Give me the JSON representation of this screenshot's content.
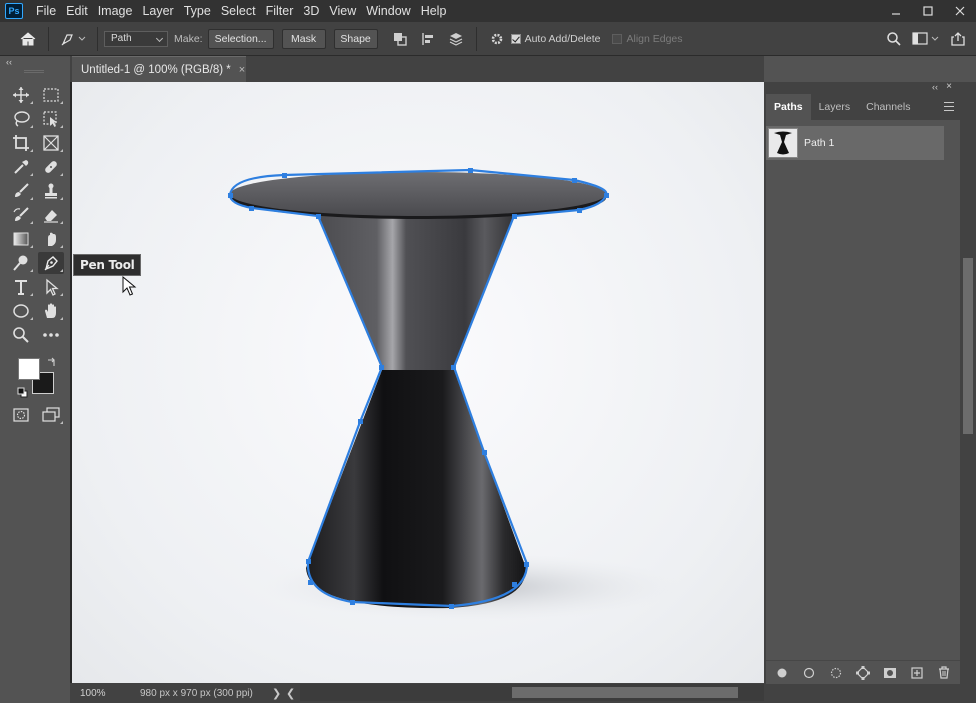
{
  "app": {
    "logo": "Ps"
  },
  "menu": [
    "File",
    "Edit",
    "Image",
    "Layer",
    "Type",
    "Select",
    "Filter",
    "3D",
    "View",
    "Window",
    "Help"
  ],
  "options": {
    "mode_value": "Path",
    "make_label": "Make:",
    "selection_label": "Selection...",
    "mask_label": "Mask",
    "shape_label": "Shape",
    "auto_add_delete_label": "Auto Add/Delete",
    "auto_add_delete_checked": true,
    "align_edges_label": "Align Edges",
    "align_edges_checked": false
  },
  "document": {
    "tab_title": "Untitled-1 @ 100% (RGB/8) *",
    "tab_close": "×",
    "zoom": "100%",
    "info": "980 px x 970 px (300 ppi)",
    "status_arrow": "❯",
    "scroll_left": "❮",
    "scroll_right": "❯"
  },
  "toolbar": {
    "collapse": "‹‹",
    "active_tool": "Pen Tool",
    "foreground_color": "#ffffff",
    "background_color": "#1a1a1a"
  },
  "tooltip": {
    "text": "Pen Tool"
  },
  "panels": {
    "tabs": [
      "Paths",
      "Layers",
      "Channels"
    ],
    "active_tab": "Paths",
    "collapse": "‹‹",
    "paths": [
      {
        "name": "Path 1"
      }
    ]
  },
  "colors": {
    "path_stroke": "#2e7fe0",
    "ui_dark": "#323232",
    "ui_panel": "#535353"
  }
}
